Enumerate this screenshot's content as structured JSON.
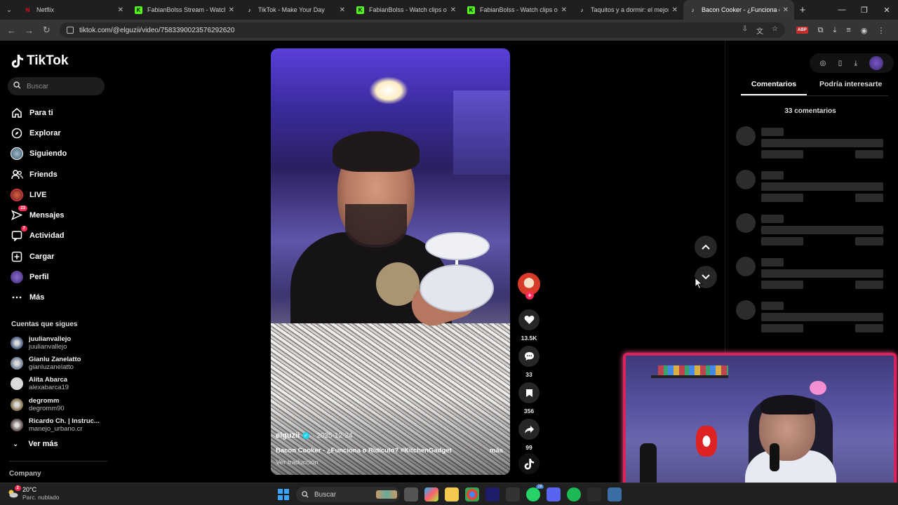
{
  "browser": {
    "tabs": [
      {
        "title": "Netflix",
        "favicon": "netflix-icon",
        "color": "#e50914",
        "active": false
      },
      {
        "title": "FabianBolss Stream - Watch Live",
        "favicon": "kick-icon",
        "color": "#53fc18",
        "active": false
      },
      {
        "title": "TikTok - Make Your Day",
        "favicon": "tiktok-icon",
        "color": "#ffffff",
        "active": false
      },
      {
        "title": "FabianBolss - Watch clips on Kick",
        "favicon": "kick-icon",
        "color": "#53fc18",
        "active": false
      },
      {
        "title": "FabianBolss - Watch clips on Kick",
        "favicon": "kick-icon",
        "color": "#53fc18",
        "active": false
      },
      {
        "title": "Taquitos y a dormir: el mejor plan",
        "favicon": "tiktok-icon",
        "color": "#ffffff",
        "active": false
      },
      {
        "title": "Bacon Cooker - ¿Funciona o Ridículo?",
        "favicon": "tiktok-icon",
        "color": "#ffffff",
        "active": true
      }
    ],
    "url": "tiktok.com/@elguzii/video/7583390023576292620"
  },
  "sidebar": {
    "brand": "TikTok",
    "search_placeholder": "Buscar",
    "nav": [
      {
        "label": "Para ti",
        "icon": "home-icon"
      },
      {
        "label": "Explorar",
        "icon": "compass-icon"
      },
      {
        "label": "Siguiendo",
        "icon": "following-avatar-icon"
      },
      {
        "label": "Friends",
        "icon": "friends-icon"
      },
      {
        "label": "LIVE",
        "icon": "live-icon"
      },
      {
        "label": "Mensajes",
        "icon": "messages-icon",
        "badge": "23"
      },
      {
        "label": "Actividad",
        "icon": "activity-icon",
        "badge": "7"
      },
      {
        "label": "Cargar",
        "icon": "upload-icon"
      },
      {
        "label": "Perfil",
        "icon": "profile-avatar-icon"
      },
      {
        "label": "Más",
        "icon": "more-icon"
      }
    ],
    "following_title": "Cuentas que sigues",
    "following": [
      {
        "name": "juulianvallejo",
        "user": "juulianvallejo",
        "color": "#5a6a8a"
      },
      {
        "name": "Gianlu Zanelatto",
        "user": "gianluzanelatto",
        "color": "#7a8a9a"
      },
      {
        "name": "Alita Abarca",
        "user": "alexabarca19",
        "color": "#d8d8d8"
      },
      {
        "name": "degromm",
        "user": "degromm90",
        "color": "#8a7a5a"
      },
      {
        "name": "Ricardo Ch. | Instruc...",
        "user": "manejo_urbano.cr",
        "color": "#6a5a5a"
      }
    ],
    "see_more": "Ver más",
    "company": "Company"
  },
  "video": {
    "username": "elguzii",
    "date": "· 2025-12-24",
    "description": "Bacon Cooker - ¿Funciona o Ridículo? #KitchenGadget",
    "more": "más",
    "translate": "Ver traducción"
  },
  "actions": {
    "likes": "13.5K",
    "comments": "33",
    "saves": "356",
    "shares": "99"
  },
  "comments_panel": {
    "tab_comments": "Comentarios",
    "tab_interest": "Podría interesarte",
    "count": "33 comentarios"
  },
  "taskbar": {
    "weather_temp": "20°C",
    "weather_desc": "Parc. nublado",
    "weather_badge": "2",
    "search_placeholder": "Buscar",
    "app_badge": "28"
  },
  "colors": {
    "accent": "#fe2c55",
    "verified": "#20d5ec",
    "cam_border": "#d8245a"
  }
}
